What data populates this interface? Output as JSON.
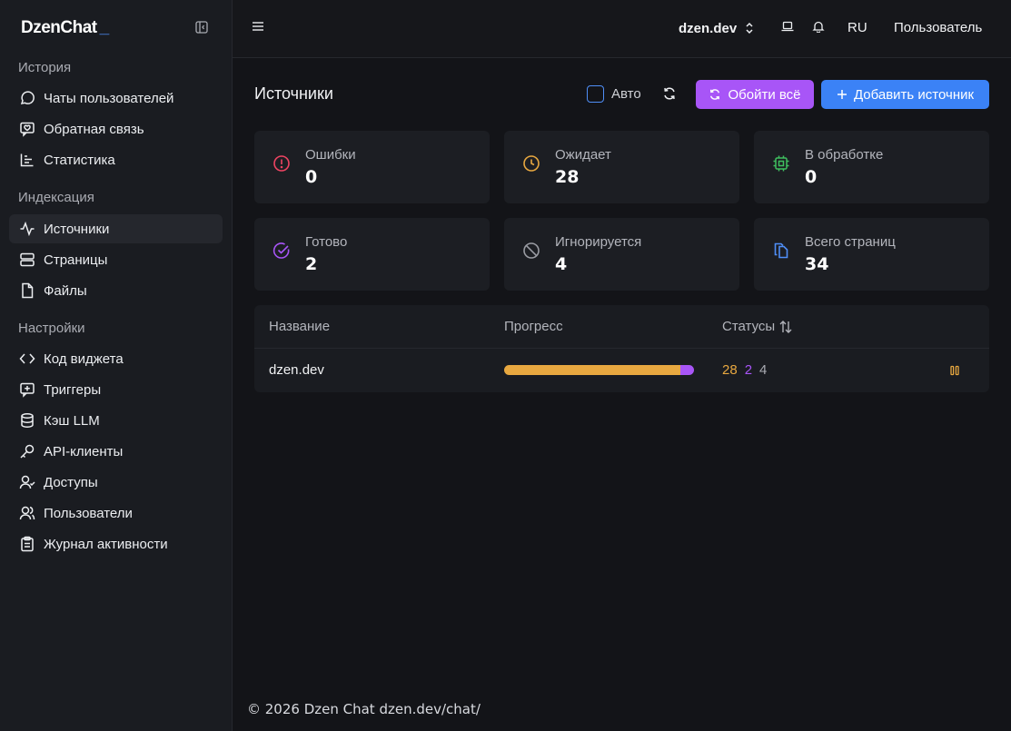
{
  "app": {
    "logo": "DzenChat",
    "logo_cursor": "_"
  },
  "sidebar": {
    "sections": [
      {
        "title": "История",
        "items": [
          {
            "label": "Чаты пользователей",
            "icon": "chat-icon"
          },
          {
            "label": "Обратная связь",
            "icon": "feedback-icon"
          },
          {
            "label": "Статистика",
            "icon": "chart-icon"
          }
        ]
      },
      {
        "title": "Индексация",
        "items": [
          {
            "label": "Источники",
            "icon": "activity-icon",
            "active": true
          },
          {
            "label": "Страницы",
            "icon": "server-icon"
          },
          {
            "label": "Файлы",
            "icon": "file-icon"
          }
        ]
      },
      {
        "title": "Настройки",
        "items": [
          {
            "label": "Код виджета",
            "icon": "code-icon"
          },
          {
            "label": "Триггеры",
            "icon": "trigger-icon"
          },
          {
            "label": "Кэш LLM",
            "icon": "database-icon"
          },
          {
            "label": "API-клиенты",
            "icon": "key-icon"
          },
          {
            "label": "Доступы",
            "icon": "user-access-icon"
          },
          {
            "label": "Пользователи",
            "icon": "users-icon"
          },
          {
            "label": "Журнал активности",
            "icon": "clipboard-icon"
          }
        ]
      }
    ]
  },
  "header": {
    "domain": "dzen.dev",
    "language": "RU",
    "user": "Пользователь"
  },
  "main": {
    "title": "Источники",
    "auto_label": "Авто",
    "crawl_all": "Обойти всё",
    "add_source": "Добавить источник",
    "stats": [
      {
        "label": "Ошибки",
        "value": "0",
        "icon": "alert-circle-icon",
        "color": "#ef4462"
      },
      {
        "label": "Ожидает",
        "value": "28",
        "icon": "clock-icon",
        "color": "#e8a840"
      },
      {
        "label": "В обработке",
        "value": "0",
        "icon": "cpu-icon",
        "color": "#3fbf5f"
      },
      {
        "label": "Готово",
        "value": "2",
        "icon": "check-circle-icon",
        "color": "#a855f7"
      },
      {
        "label": "Игнорируется",
        "value": "4",
        "icon": "ban-icon",
        "color": "#9a9ca3"
      },
      {
        "label": "Всего страниц",
        "value": "34",
        "icon": "copy-icon",
        "color": "#4f8ef7"
      }
    ],
    "table": {
      "headers": {
        "name": "Название",
        "progress": "Прогресс",
        "statuses": "Статусы"
      },
      "rows": [
        {
          "name": "dzen.dev",
          "progress_waiting": 0.93,
          "progress_done": 0.07,
          "waiting": "28",
          "done": "2",
          "ignored": "4"
        }
      ]
    }
  },
  "footer": {
    "text": "© 2026 Dzen Chat dzen.dev/chat/"
  }
}
